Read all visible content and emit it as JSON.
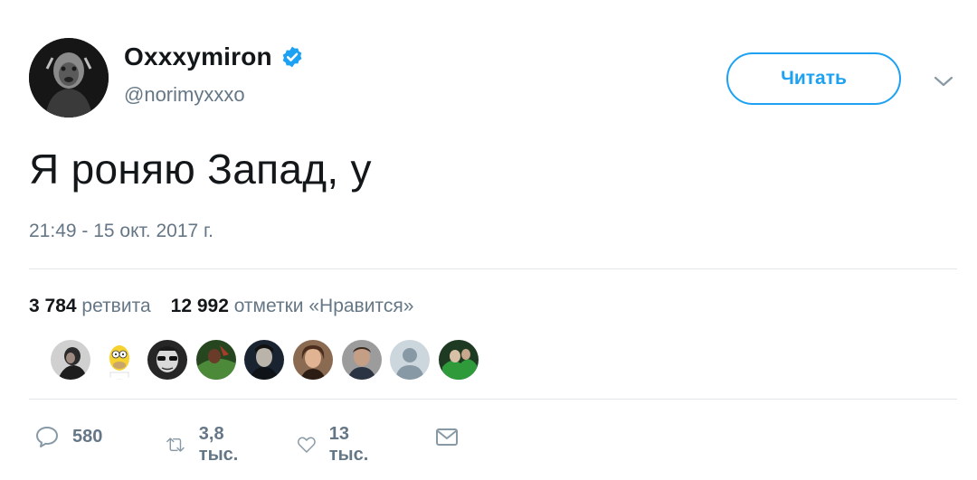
{
  "author": {
    "name": "Oxxxymiron",
    "handle": "@norimyxxxo",
    "verified": true,
    "avatar_icon": "profile-photo-dark"
  },
  "follow_button": {
    "label": "Читать"
  },
  "tweet": {
    "text": "Я роняю Запад, у",
    "timestamp": "21:49 - 15 окт. 2017 г."
  },
  "stats": {
    "retweets_count": "3 784",
    "retweets_label": "ретвита",
    "likes_count": "12 992",
    "likes_label": "отметки «Нравится»"
  },
  "likers": [
    {
      "icon": "avatar-photo-1",
      "bg": "#c9c9c9"
    },
    {
      "icon": "avatar-cartoon-yellow",
      "bg": "#ffffff"
    },
    {
      "icon": "avatar-photo-glasses",
      "bg": "#2a2a2a"
    },
    {
      "icon": "avatar-photo-green",
      "bg": "#2f5a2a"
    },
    {
      "icon": "avatar-photo-dark",
      "bg": "#1e2a36"
    },
    {
      "icon": "avatar-photo-warm",
      "bg": "#7a5a44"
    },
    {
      "icon": "avatar-photo-person",
      "bg": "#8d8d8d"
    },
    {
      "icon": "avatar-default-placeholder",
      "bg": "#cdd6dd"
    },
    {
      "icon": "avatar-photo-green-2",
      "bg": "#2d7a34"
    }
  ],
  "actions": {
    "reply_count": "580",
    "retweet_count": "3,8 тыс.",
    "like_count": "13 тыс."
  },
  "colors": {
    "accent": "#1da1f2",
    "secondary_text": "#657786",
    "primary_text": "#14171a",
    "divider": "#e1e8ed"
  }
}
